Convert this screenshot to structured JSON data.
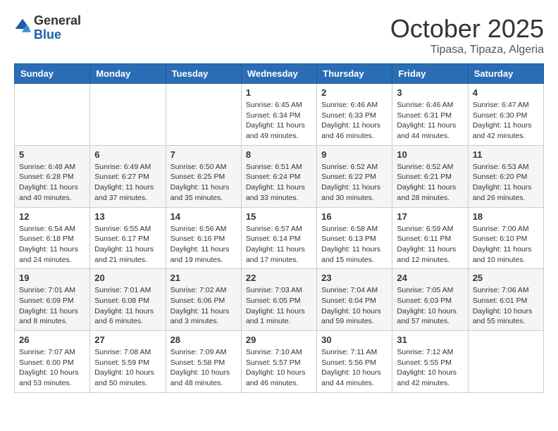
{
  "header": {
    "logo_general": "General",
    "logo_blue": "Blue",
    "month": "October 2025",
    "location": "Tipasa, Tipaza, Algeria"
  },
  "days_of_week": [
    "Sunday",
    "Monday",
    "Tuesday",
    "Wednesday",
    "Thursday",
    "Friday",
    "Saturday"
  ],
  "weeks": [
    [
      {
        "day": "",
        "info": ""
      },
      {
        "day": "",
        "info": ""
      },
      {
        "day": "",
        "info": ""
      },
      {
        "day": "1",
        "info": "Sunrise: 6:45 AM\nSunset: 6:34 PM\nDaylight: 11 hours and 49 minutes."
      },
      {
        "day": "2",
        "info": "Sunrise: 6:46 AM\nSunset: 6:33 PM\nDaylight: 11 hours and 46 minutes."
      },
      {
        "day": "3",
        "info": "Sunrise: 6:46 AM\nSunset: 6:31 PM\nDaylight: 11 hours and 44 minutes."
      },
      {
        "day": "4",
        "info": "Sunrise: 6:47 AM\nSunset: 6:30 PM\nDaylight: 11 hours and 42 minutes."
      }
    ],
    [
      {
        "day": "5",
        "info": "Sunrise: 6:48 AM\nSunset: 6:28 PM\nDaylight: 11 hours and 40 minutes."
      },
      {
        "day": "6",
        "info": "Sunrise: 6:49 AM\nSunset: 6:27 PM\nDaylight: 11 hours and 37 minutes."
      },
      {
        "day": "7",
        "info": "Sunrise: 6:50 AM\nSunset: 6:25 PM\nDaylight: 11 hours and 35 minutes."
      },
      {
        "day": "8",
        "info": "Sunrise: 6:51 AM\nSunset: 6:24 PM\nDaylight: 11 hours and 33 minutes."
      },
      {
        "day": "9",
        "info": "Sunrise: 6:52 AM\nSunset: 6:22 PM\nDaylight: 11 hours and 30 minutes."
      },
      {
        "day": "10",
        "info": "Sunrise: 6:52 AM\nSunset: 6:21 PM\nDaylight: 11 hours and 28 minutes."
      },
      {
        "day": "11",
        "info": "Sunrise: 6:53 AM\nSunset: 6:20 PM\nDaylight: 11 hours and 26 minutes."
      }
    ],
    [
      {
        "day": "12",
        "info": "Sunrise: 6:54 AM\nSunset: 6:18 PM\nDaylight: 11 hours and 24 minutes."
      },
      {
        "day": "13",
        "info": "Sunrise: 6:55 AM\nSunset: 6:17 PM\nDaylight: 11 hours and 21 minutes."
      },
      {
        "day": "14",
        "info": "Sunrise: 6:56 AM\nSunset: 6:16 PM\nDaylight: 11 hours and 19 minutes."
      },
      {
        "day": "15",
        "info": "Sunrise: 6:57 AM\nSunset: 6:14 PM\nDaylight: 11 hours and 17 minutes."
      },
      {
        "day": "16",
        "info": "Sunrise: 6:58 AM\nSunset: 6:13 PM\nDaylight: 11 hours and 15 minutes."
      },
      {
        "day": "17",
        "info": "Sunrise: 6:59 AM\nSunset: 6:11 PM\nDaylight: 11 hours and 12 minutes."
      },
      {
        "day": "18",
        "info": "Sunrise: 7:00 AM\nSunset: 6:10 PM\nDaylight: 11 hours and 10 minutes."
      }
    ],
    [
      {
        "day": "19",
        "info": "Sunrise: 7:01 AM\nSunset: 6:09 PM\nDaylight: 11 hours and 8 minutes."
      },
      {
        "day": "20",
        "info": "Sunrise: 7:01 AM\nSunset: 6:08 PM\nDaylight: 11 hours and 6 minutes."
      },
      {
        "day": "21",
        "info": "Sunrise: 7:02 AM\nSunset: 6:06 PM\nDaylight: 11 hours and 3 minutes."
      },
      {
        "day": "22",
        "info": "Sunrise: 7:03 AM\nSunset: 6:05 PM\nDaylight: 11 hours and 1 minute."
      },
      {
        "day": "23",
        "info": "Sunrise: 7:04 AM\nSunset: 6:04 PM\nDaylight: 10 hours and 59 minutes."
      },
      {
        "day": "24",
        "info": "Sunrise: 7:05 AM\nSunset: 6:03 PM\nDaylight: 10 hours and 57 minutes."
      },
      {
        "day": "25",
        "info": "Sunrise: 7:06 AM\nSunset: 6:01 PM\nDaylight: 10 hours and 55 minutes."
      }
    ],
    [
      {
        "day": "26",
        "info": "Sunrise: 7:07 AM\nSunset: 6:00 PM\nDaylight: 10 hours and 53 minutes."
      },
      {
        "day": "27",
        "info": "Sunrise: 7:08 AM\nSunset: 5:59 PM\nDaylight: 10 hours and 50 minutes."
      },
      {
        "day": "28",
        "info": "Sunrise: 7:09 AM\nSunset: 5:58 PM\nDaylight: 10 hours and 48 minutes."
      },
      {
        "day": "29",
        "info": "Sunrise: 7:10 AM\nSunset: 5:57 PM\nDaylight: 10 hours and 46 minutes."
      },
      {
        "day": "30",
        "info": "Sunrise: 7:11 AM\nSunset: 5:56 PM\nDaylight: 10 hours and 44 minutes."
      },
      {
        "day": "31",
        "info": "Sunrise: 7:12 AM\nSunset: 5:55 PM\nDaylight: 10 hours and 42 minutes."
      },
      {
        "day": "",
        "info": ""
      }
    ]
  ]
}
